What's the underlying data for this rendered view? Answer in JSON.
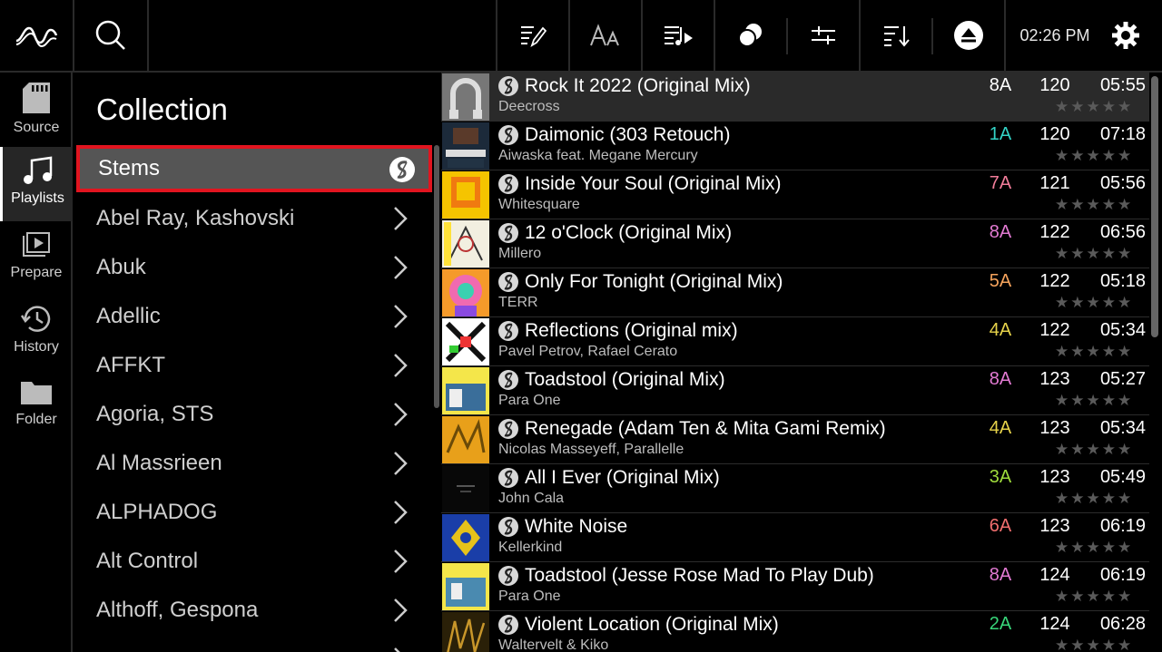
{
  "topbar": {
    "clock": "02:26 PM",
    "icons": [
      "logo-icon",
      "search-icon",
      "edit-list-icon",
      "text-size-icon",
      "playlist-play-icon",
      "stems-toggle-icon",
      "sliders-icon",
      "sort-icon",
      "eject-icon",
      "gear-icon"
    ]
  },
  "nav": {
    "items": [
      {
        "label": "Source",
        "icon": "sd-card-icon"
      },
      {
        "label": "Playlists",
        "icon": "music-note-icon"
      },
      {
        "label": "Prepare",
        "icon": "prepare-icon"
      },
      {
        "label": "History",
        "icon": "history-icon"
      },
      {
        "label": "Folder",
        "icon": "folder-icon"
      }
    ],
    "active": "Playlists"
  },
  "collection": {
    "title": "Collection",
    "selected": "Stems",
    "items": [
      {
        "label": "Stems"
      },
      {
        "label": "Abel Ray, Kashovski"
      },
      {
        "label": "Abuk"
      },
      {
        "label": "Adellic"
      },
      {
        "label": "AFFKT"
      },
      {
        "label": "Agoria, STS"
      },
      {
        "label": "Al Massrieen"
      },
      {
        "label": "ALPHADOG"
      },
      {
        "label": "Alt Control"
      },
      {
        "label": "Althoff, Gespona"
      }
    ]
  },
  "tracks": [
    {
      "title": "Rock It 2022 (Original Mix)",
      "artist": "Deecross",
      "key": "8A",
      "key_color": "#ffffff",
      "bpm": "120",
      "time": "05:55",
      "stars": "★★★★★"
    },
    {
      "title": "Daimonic (303 Retouch)",
      "artist": "Aiwaska feat. Megane Mercury",
      "key": "1A",
      "key_color": "#33d3c6",
      "bpm": "120",
      "time": "07:18",
      "stars": "★★★★★"
    },
    {
      "title": "Inside Your Soul (Original Mix)",
      "artist": "Whitesquare",
      "key": "7A",
      "key_color": "#f27d9a",
      "bpm": "121",
      "time": "05:56",
      "stars": "★★★★★"
    },
    {
      "title": "12 o'Clock (Original Mix)",
      "artist": "Millero",
      "key": "8A",
      "key_color": "#e27ad2",
      "bpm": "122",
      "time": "06:56",
      "stars": "★★★★★"
    },
    {
      "title": "Only For Tonight (Original Mix)",
      "artist": "TERR",
      "key": "5A",
      "key_color": "#f5a35c",
      "bpm": "122",
      "time": "05:18",
      "stars": "★★★★★"
    },
    {
      "title": "Reflections (Original mix)",
      "artist": "Pavel Petrov, Rafael Cerato",
      "key": "4A",
      "key_color": "#e6d24a",
      "bpm": "122",
      "time": "05:34",
      "stars": "★★★★★"
    },
    {
      "title": "Toadstool (Original Mix)",
      "artist": "Para One",
      "key": "8A",
      "key_color": "#e27ad2",
      "bpm": "123",
      "time": "05:27",
      "stars": "★★★★★"
    },
    {
      "title": "Renegade (Adam Ten & Mita Gami Remix)",
      "artist": "Nicolas Masseyeff, Parallelle",
      "key": "4A",
      "key_color": "#e6d24a",
      "bpm": "123",
      "time": "05:34",
      "stars": "★★★★★"
    },
    {
      "title": "All I Ever (Original Mix)",
      "artist": "John Cala",
      "key": "3A",
      "key_color": "#9fdc3c",
      "bpm": "123",
      "time": "05:49",
      "stars": "★★★★★"
    },
    {
      "title": "White Noise",
      "artist": "Kellerkind",
      "key": "6A",
      "key_color": "#f06e6e",
      "bpm": "123",
      "time": "06:19",
      "stars": "★★★★★"
    },
    {
      "title": "Toadstool (Jesse Rose Mad To Play Dub)",
      "artist": "Para One",
      "key": "8A",
      "key_color": "#e27ad2",
      "bpm": "124",
      "time": "06:19",
      "stars": "★★★★★"
    },
    {
      "title": "Violent Location (Original Mix)",
      "artist": "Waltervelt & Kiko",
      "key": "2A",
      "key_color": "#38d67a",
      "bpm": "124",
      "time": "06:28",
      "stars": "★★★★★"
    }
  ],
  "colors": {
    "accent_red": "#e1141f",
    "selected_bg": "#555555",
    "current_track_bg": "#2a2a2a"
  }
}
